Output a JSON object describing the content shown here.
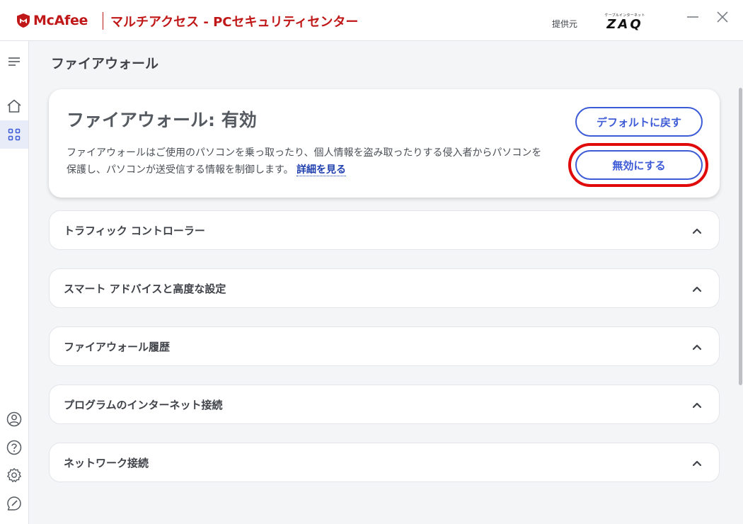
{
  "brand": {
    "name": "McAfee",
    "app_title": "マルチアクセス - PCセキュリティセンター",
    "color": "#c01818"
  },
  "provider": {
    "label": "提供元",
    "logo_small": "ケーブルインターネット",
    "logo_big": "ZAQ"
  },
  "window_controls": [
    "minimize-icon",
    "close-icon"
  ],
  "sidebar": {
    "top": [
      "menu-icon",
      "home-icon",
      "apps-grid-icon"
    ],
    "bottom": [
      "account-icon",
      "help-icon",
      "settings-icon",
      "feedback-icon"
    ],
    "active": "apps-grid-icon"
  },
  "page": {
    "title": "ファイアウォール"
  },
  "firewall": {
    "heading": "ファイアウォール: 有効",
    "description": "ファイアウォールはご使用のパソコンを乗っ取ったり、個人情報を盗み取ったりする侵入者からパソコンを保護し、パソコンが送受信する情報を制御します。",
    "link": "詳細を見る",
    "default_button": "デフォルトに戻す",
    "disable_button": "無効にする",
    "accent": "#3d5bd6",
    "highlight": "#e10a0a"
  },
  "sections": [
    {
      "label": "トラフィック コントローラー",
      "icon": "chevron-up-icon"
    },
    {
      "label": "スマート アドバイスと高度な設定",
      "icon": "chevron-up-icon"
    },
    {
      "label": "ファイアウォール履歴",
      "icon": "chevron-up-icon"
    },
    {
      "label": "プログラムのインターネット接続",
      "icon": "chevron-up-icon"
    },
    {
      "label": "ネットワーク接続",
      "icon": "chevron-up-icon"
    }
  ]
}
